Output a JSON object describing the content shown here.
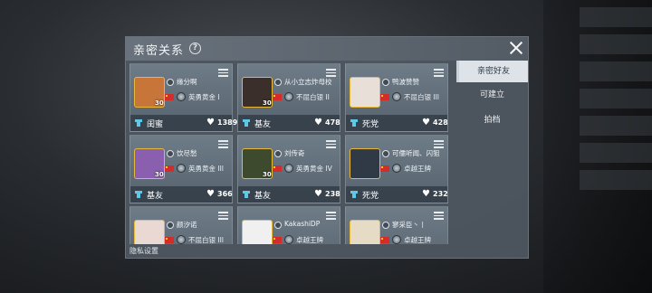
{
  "panel": {
    "title": "亲密关系",
    "privacy_label": "隐私设置"
  },
  "tabs": [
    {
      "label": "亲密好友",
      "active": true
    },
    {
      "label": "可建立",
      "active": false
    },
    {
      "label": "拍档",
      "active": false
    }
  ],
  "cards": [
    {
      "name": "缘分啊",
      "level": "30",
      "rank": "英勇黄金 I",
      "relation": "闺蜜",
      "score": "1389",
      "avatar_bg": "#c8753a"
    },
    {
      "name": "从小立志炸母校",
      "level": "30",
      "rank": "不屈白银 II",
      "relation": "基友",
      "score": "478",
      "avatar_bg": "#3a2f2a"
    },
    {
      "name": "鸭波赞赞",
      "level": "",
      "rank": "不屈白银 III",
      "relation": "死党",
      "score": "428",
      "avatar_bg": "#e8e0d8"
    },
    {
      "name": "饮尽愁",
      "level": "30",
      "rank": "英勇黄金 III",
      "relation": "基友",
      "score": "366",
      "avatar_bg": "#8a5fb0"
    },
    {
      "name": "刘传奇",
      "level": "30",
      "rank": "英勇黄金 IV",
      "relation": "基友",
      "score": "238",
      "avatar_bg": "#3d4a2e"
    },
    {
      "name": "可儒听闻、闪狙",
      "level": "",
      "rank": "卓越王牌",
      "relation": "死党",
      "score": "232",
      "avatar_bg": "#2f3a46"
    },
    {
      "name": "颜汐诺",
      "level": "",
      "rank": "不屈白银 III",
      "relation": "",
      "score": "",
      "avatar_bg": "#e9d9d2"
    },
    {
      "name": "KakashiDP",
      "level": "",
      "rank": "卓越王牌",
      "relation": "",
      "score": "",
      "avatar_bg": "#f0f0f0"
    },
    {
      "name": "寥采臣丶丨",
      "level": "",
      "rank": "卓越王牌",
      "relation": "",
      "score": "",
      "avatar_bg": "#e6dcc6"
    }
  ]
}
